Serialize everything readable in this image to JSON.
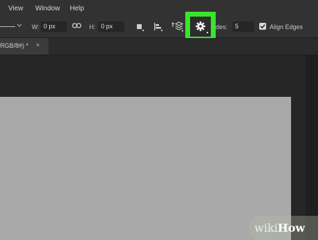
{
  "menu": {
    "items": [
      {
        "label": "View"
      },
      {
        "label": "Window"
      },
      {
        "label": "Help"
      }
    ]
  },
  "options": {
    "stroke_dropdown_icon": "chevron-down-icon",
    "width_label": "W:",
    "width_value": "0 px",
    "link_icon": "link-icon",
    "height_label": "H:",
    "height_value": "0 px",
    "path_ops_icon": "square-icon",
    "align_icon": "align-icon",
    "arrange_icon": "stack-layers-icon",
    "gear_icon": "gear-icon",
    "sides_label": "des:",
    "sides_value": "5",
    "align_edges_label": "Align Edges",
    "align_edges_checked": true,
    "highlight_color": "#38e52c"
  },
  "tab": {
    "label": "RGB/8#) *",
    "close_label": "×"
  },
  "watermark": {
    "wiki": "wiki",
    "how": "How"
  }
}
